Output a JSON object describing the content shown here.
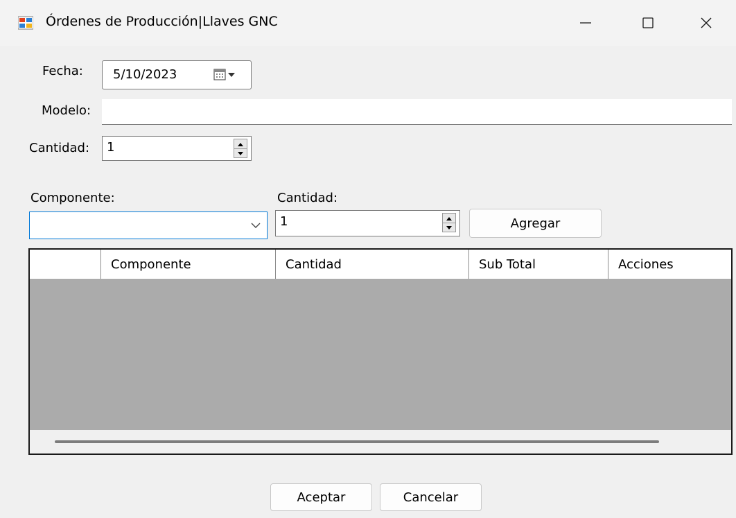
{
  "window": {
    "title": "Órdenes de Producción|Llaves GNC",
    "icon": "windows-form-icon"
  },
  "form": {
    "fecha_label": "Fecha:",
    "fecha_value": "5/10/2023",
    "modelo_label": "Modelo:",
    "modelo_value": "",
    "cantidad_label": "Cantidad:",
    "cantidad_value": "1"
  },
  "detalle": {
    "componente_label": "Componente:",
    "componente_value": "",
    "cantidad_label": "Cantidad:",
    "cantidad_value": "1",
    "agregar_label": "Agregar"
  },
  "grid": {
    "columns": [
      "",
      "Componente",
      "Cantidad",
      "Sub Total",
      "Acciones"
    ],
    "rows": []
  },
  "footer": {
    "aceptar_label": "Aceptar",
    "cancelar_label": "Cancelar"
  },
  "colors": {
    "window_bg": "#f0f0f0",
    "grid_bg": "#ababab",
    "focus_border": "#0078d7"
  }
}
